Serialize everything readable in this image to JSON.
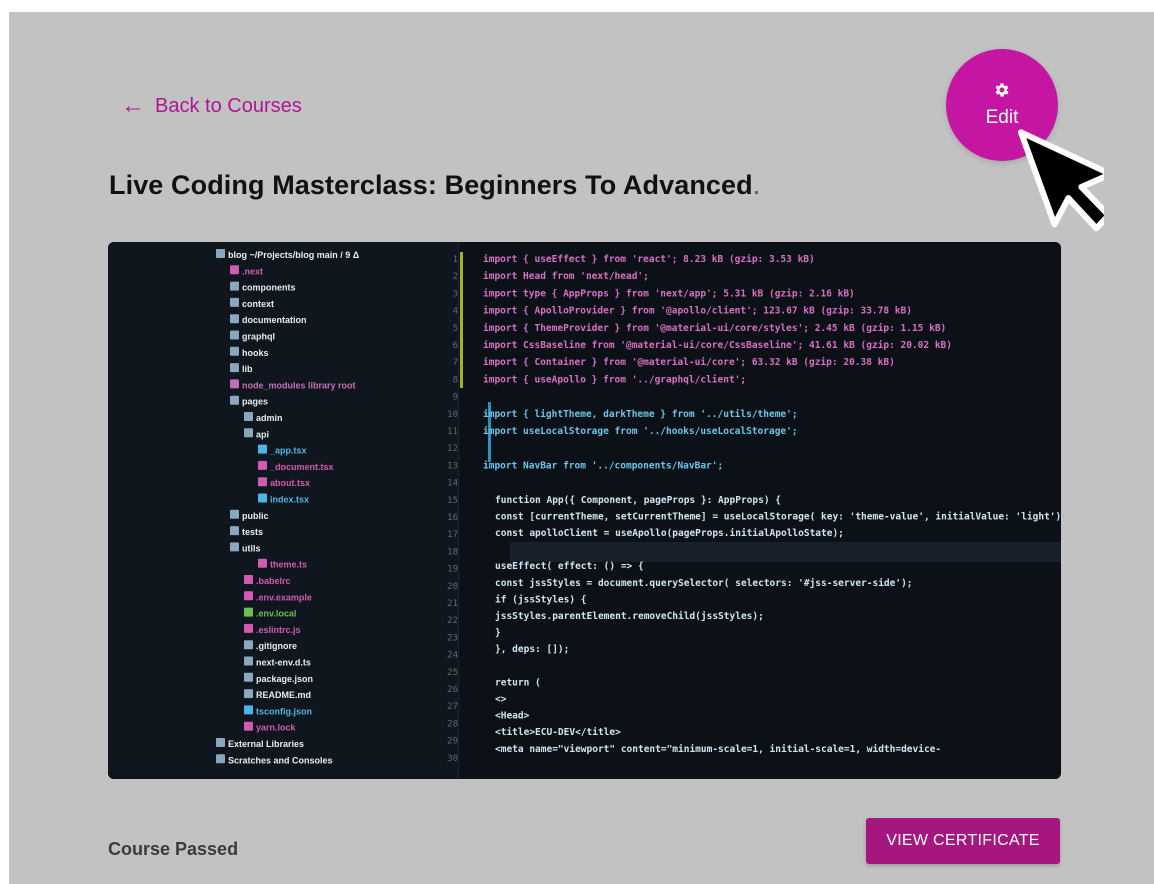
{
  "nav": {
    "back_label": "Back to Courses",
    "back_icon": "arrow-left-icon"
  },
  "course": {
    "title": "Live Coding Masterclass: Beginners To Advanced",
    "title_suffix": "."
  },
  "edit": {
    "label": "Edit",
    "icon": "gear-icon"
  },
  "footer": {
    "status": "Course Passed",
    "certificate_label": "VIEW CERTIFICATE"
  },
  "colors": {
    "accent": "#c416a3",
    "button": "#a5177f",
    "link": "#b21593",
    "background": "#c2c2c2"
  },
  "hero_image": {
    "tree": [
      "blog  ~/Projects/blog main / 9 Δ",
      ".next",
      "components",
      "context",
      "documentation",
      "graphql",
      "hooks",
      "lib",
      "node_modules  library root",
      "pages",
      "admin",
      "api",
      "_app.tsx",
      "_document.tsx",
      "about.tsx",
      "index.tsx",
      "public",
      "tests",
      "utils",
      "theme.ts",
      ".babelrc",
      ".env.example",
      ".env.local",
      ".eslintrc.js",
      ".gitignore",
      "next-env.d.ts",
      "package.json",
      "README.md",
      "tsconfig.json",
      "yarn.lock",
      "External Libraries",
      "Scratches and Consoles"
    ],
    "code": [
      "import { useEffect } from 'react';  8.23 kB (gzip: 3.53 kB)",
      "import Head from 'next/head';",
      "import type { AppProps } from 'next/app';  5.31 kB (gzip: 2.16 kB)",
      "import { ApolloProvider } from '@apollo/client';  123.67 kB (gzip: 33.78 kB)",
      "import { ThemeProvider } from '@material-ui/core/styles';  2.45 kB (gzip: 1.15 kB)",
      "import CssBaseline from '@material-ui/core/CssBaseline';  41.61 kB (gzip: 20.02 kB)",
      "import { Container } from '@material-ui/core';  63.32 kB (gzip: 20.38 kB)",
      "import { useApollo } from '../graphql/client';",
      "",
      "import { lightTheme, darkTheme } from '../utils/theme';",
      "import useLocalStorage from '../hooks/useLocalStorage';",
      "",
      "import NavBar from '../components/NavBar';",
      "",
      "function App({ Component, pageProps }: AppProps) {",
      "  const [currentTheme, setCurrentTheme] = useLocalStorage( key: 'theme-value',  initialValue: 'light');",
      "  const apolloClient = useApollo(pageProps.initialApolloState);",
      "",
      "  useEffect( effect: () => {",
      "    const jssStyles = document.querySelector( selectors: '#jss-server-side');",
      "    if (jssStyles) {",
      "      jssStyles.parentElement.removeChild(jssStyles);",
      "    }",
      "  },  deps: []);",
      "",
      "  return (",
      "    <>",
      "      <Head>",
      "        <title>ECU-DEV</title>",
      "        <meta name=\"viewport\" content=\"minimum-scale=1, initial-scale=1, width=device-"
    ]
  }
}
